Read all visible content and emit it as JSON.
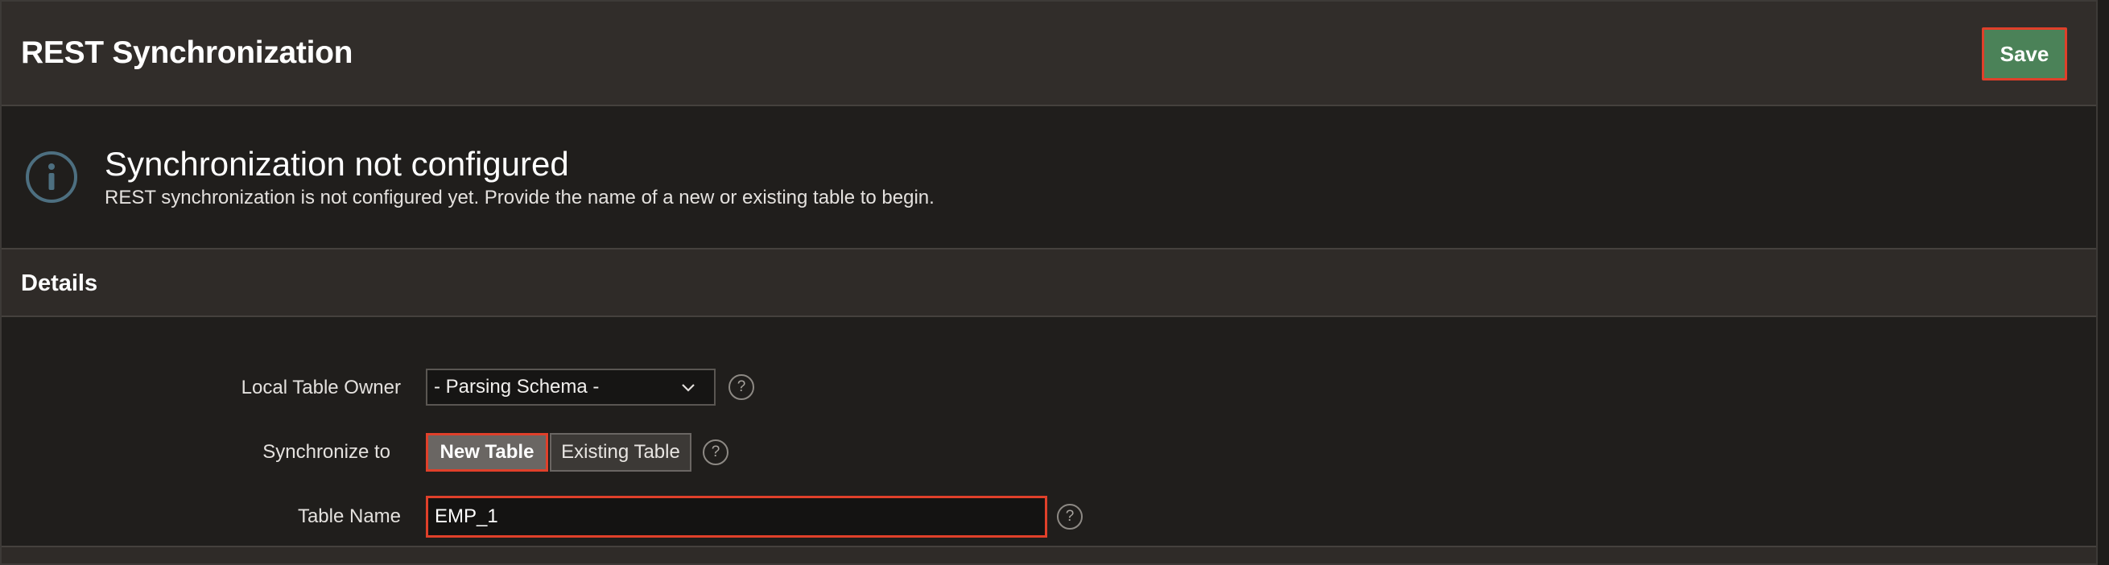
{
  "page": {
    "title": "REST Synchronization",
    "save_label": "Save"
  },
  "alert": {
    "icon": "info-icon",
    "title": "Synchronization not configured",
    "message": "REST synchronization is not configured yet. Provide the name of a new or existing table to begin."
  },
  "details": {
    "title": "Details",
    "local_table_owner": {
      "label": "Local Table Owner",
      "value": "- Parsing Schema -"
    },
    "synchronize_to": {
      "label": "Synchronize to",
      "options": [
        "New Table",
        "Existing Table"
      ],
      "selected": "New Table"
    },
    "table_name": {
      "label": "Table Name",
      "value": "EMP_1"
    },
    "help_symbol": "?"
  },
  "colors": {
    "accent_save": "#4b8258",
    "focus_highlight": "#e0402a",
    "info_icon": "#4d6f80"
  }
}
